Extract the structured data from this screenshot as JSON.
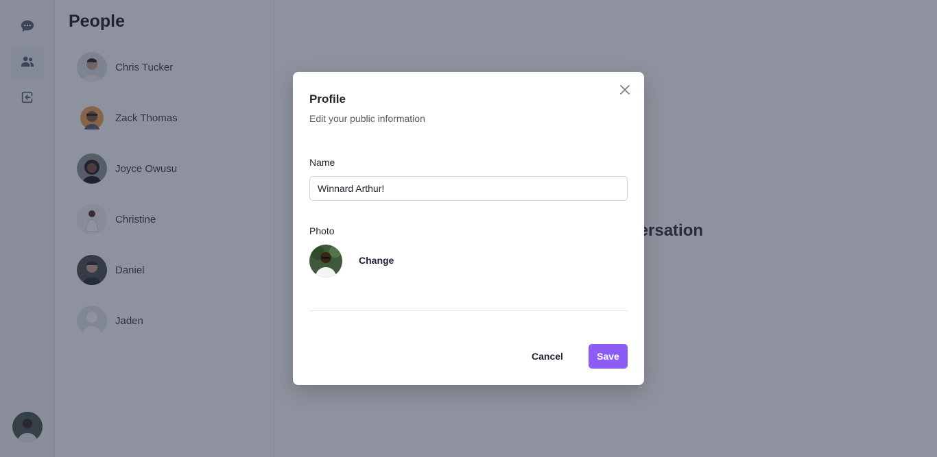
{
  "colors": {
    "accent": "#8b5cf6",
    "overlay": "rgba(30,37,61,0.5)"
  },
  "rail": {
    "items": [
      {
        "icon": "chat-bubble-icon",
        "active": false
      },
      {
        "icon": "people-icon",
        "active": true
      },
      {
        "icon": "logout-icon",
        "active": false
      }
    ],
    "current_user_avatar": "user-avatar"
  },
  "people": {
    "title": "People",
    "items": [
      {
        "name": "Chris Tucker"
      },
      {
        "name": "Zack Thomas"
      },
      {
        "name": "Joyce Owusu"
      },
      {
        "name": "Christine"
      },
      {
        "name": "Daniel"
      },
      {
        "name": "Jaden"
      }
    ]
  },
  "main": {
    "empty_text": "Start a new conversation"
  },
  "modal": {
    "title": "Profile",
    "subtitle": "Edit your public information",
    "name_label": "Name",
    "name_value": "Winnard Arthur!",
    "photo_label": "Photo",
    "change_label": "Change",
    "cancel_label": "Cancel",
    "save_label": "Save"
  }
}
